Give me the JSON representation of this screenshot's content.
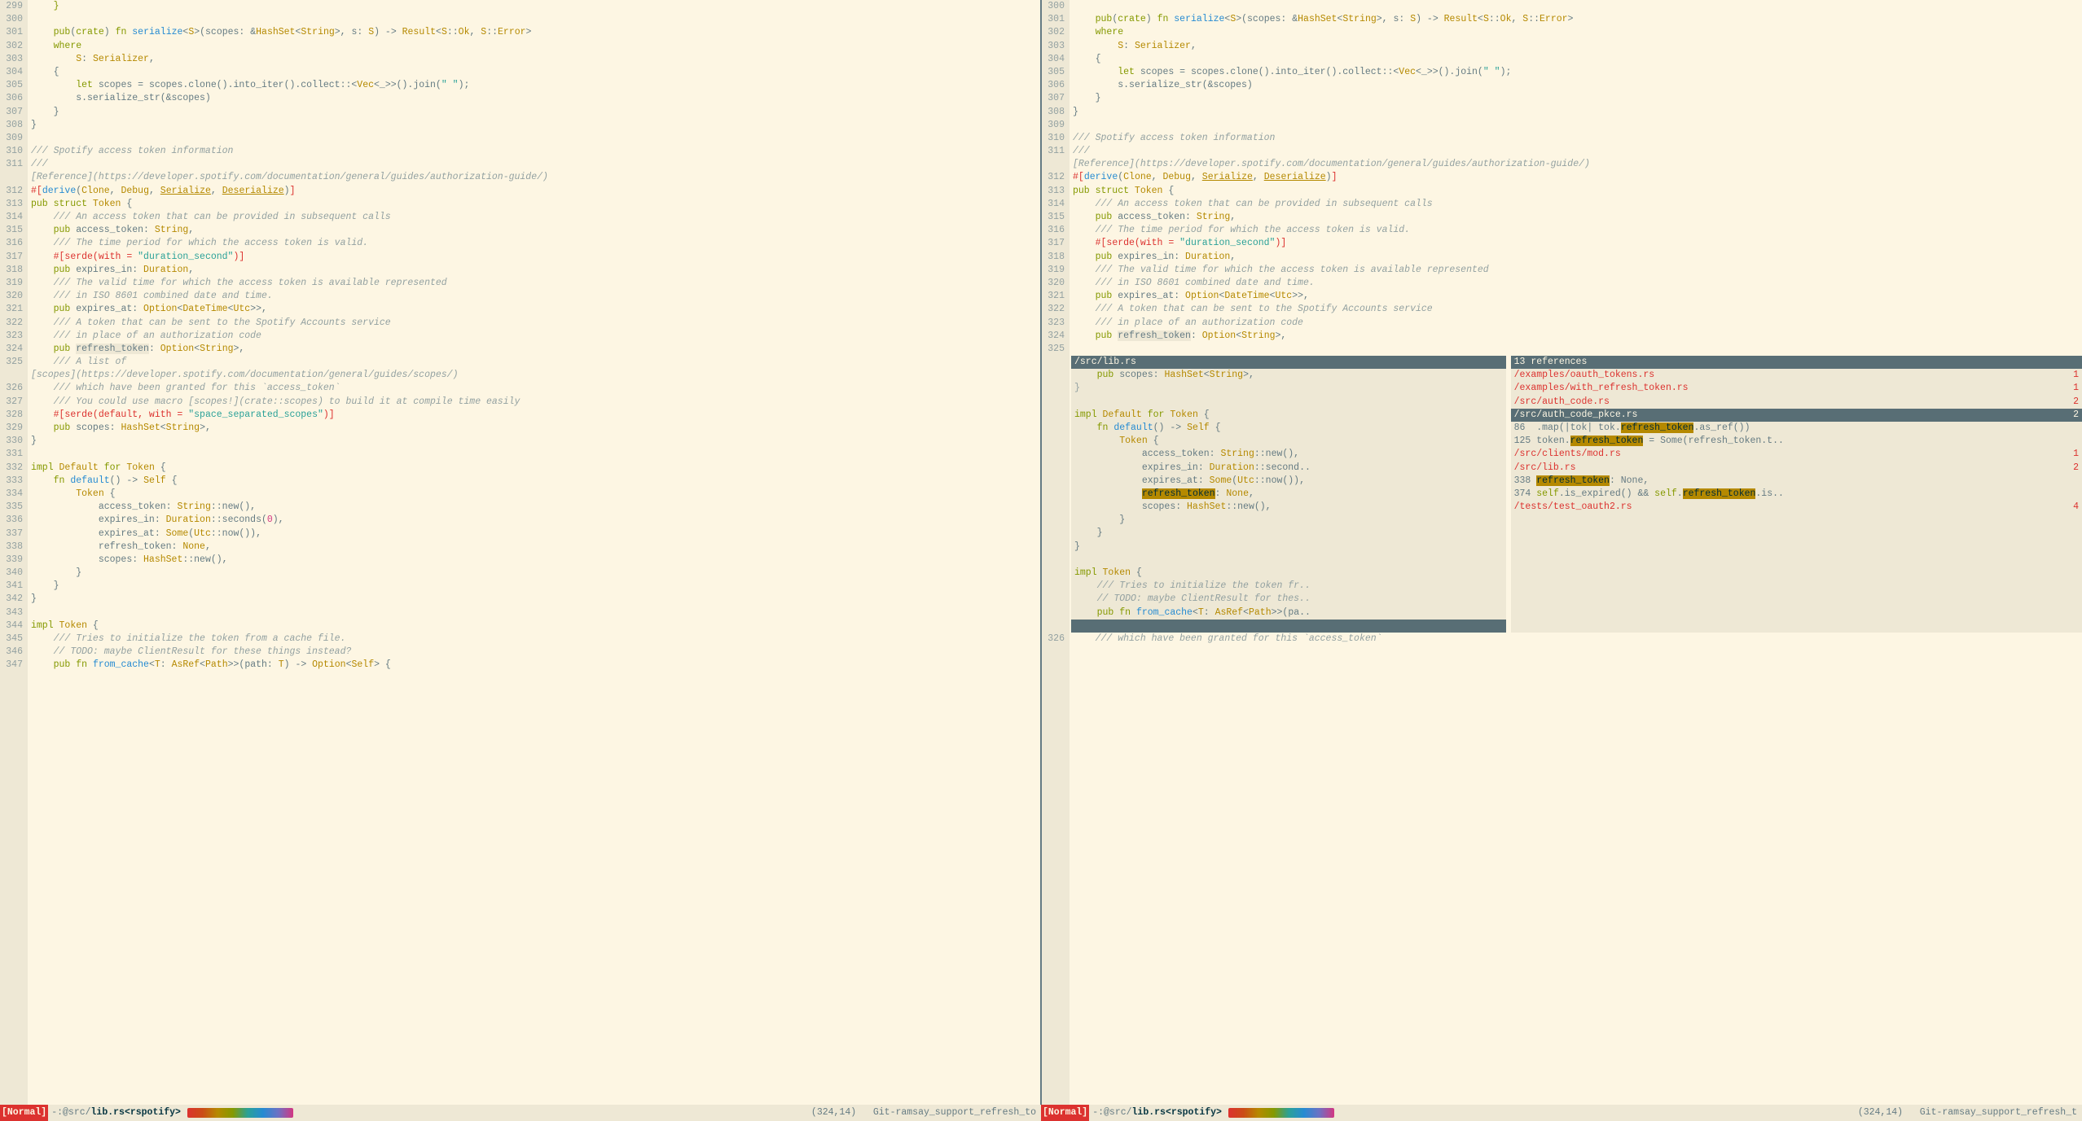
{
  "left": {
    "lines": [
      {
        "n": 299,
        "html": "    <span class='k-keyword'>}</span>"
      },
      {
        "n": 300,
        "html": ""
      },
      {
        "n": 301,
        "html": "    <span class='k-keyword'>pub</span>(<span class='k-keyword'>crate</span>) <span class='k-keyword'>fn</span> <span class='k-fn'>serialize</span>&lt;<span class='k-type'>S</span>&gt;(scopes: &amp;<span class='k-type'>HashSet</span>&lt;<span class='k-type'>String</span>&gt;, s: <span class='k-type'>S</span>) -&gt; <span class='k-type'>Result</span>&lt;<span class='k-type'>S</span>::<span class='k-type'>Ok</span>, <span class='k-type'>S</span>::<span class='k-type'>Error</span>&gt;"
      },
      {
        "n": 302,
        "html": "    <span class='k-keyword'>where</span>"
      },
      {
        "n": 303,
        "html": "        <span class='k-type'>S</span>: <span class='k-type'>Serializer</span>,"
      },
      {
        "n": 304,
        "html": "    {"
      },
      {
        "n": 305,
        "html": "        <span class='k-keyword'>let</span> scopes = scopes.clone().into_iter().collect::&lt;<span class='k-type'>Vec</span>&lt;_&gt;&gt;().join(<span class='k-string'>\" \"</span>);"
      },
      {
        "n": 306,
        "html": "        s.serialize_str(&amp;scopes)"
      },
      {
        "n": 307,
        "html": "    }"
      },
      {
        "n": 308,
        "html": "}"
      },
      {
        "n": 309,
        "html": ""
      },
      {
        "n": 310,
        "html": "<span class='k-comment'>/// Spotify access token information</span>"
      },
      {
        "n": 311,
        "html": "<span class='k-comment'>///</span>"
      },
      {
        "n": "",
        "html": "<span class='k-comment'>[Reference](https://developer.spotify.com/documentation/general/guides/authorization-guide/)</span>"
      },
      {
        "n": 312,
        "html": "<span class='k-attr'>#[</span><span class='k-fn'>derive</span>(<span class='k-type'>Clone</span>, <span class='k-type'>Debug</span>, <span class='k-underline k-type'>Serialize</span>, <span class='k-underline k-type'>Deserialize</span>)<span class='k-attr'>]</span>"
      },
      {
        "n": 313,
        "html": "<span class='k-keyword'>pub struct</span> <span class='k-type'>Token</span> {"
      },
      {
        "n": 314,
        "html": "    <span class='k-comment'>/// An access token that can be provided in subsequent calls</span>"
      },
      {
        "n": 315,
        "html": "    <span class='k-keyword'>pub</span> access_token: <span class='k-type'>String</span>,"
      },
      {
        "n": 316,
        "html": "    <span class='k-comment'>/// The time period for which the access token is valid.</span>"
      },
      {
        "n": 317,
        "html": "    <span class='k-attr'>#[serde(with = <span class='k-string'>\"duration_second\"</span>)]</span>"
      },
      {
        "n": 318,
        "html": "    <span class='k-keyword'>pub</span> expires_in: <span class='k-type'>Duration</span>,"
      },
      {
        "n": 319,
        "html": "    <span class='k-comment'>/// The valid time for which the access token is available represented</span>"
      },
      {
        "n": 320,
        "html": "    <span class='k-comment'>/// in ISO 8601 combined date and time.</span>"
      },
      {
        "n": 321,
        "html": "    <span class='k-keyword'>pub</span> expires_at: <span class='k-type'>Option</span>&lt;<span class='k-type'>DateTime</span>&lt;<span class='k-type'>Utc</span>&gt;&gt;,"
      },
      {
        "n": 322,
        "html": "    <span class='k-comment'>/// A token that can be sent to the Spotify Accounts service</span>"
      },
      {
        "n": 323,
        "html": "    <span class='k-comment'>/// in place of an authorization code</span>"
      },
      {
        "n": 324,
        "html": "    <span class='k-keyword'>pub</span> <span class='cursor-highlight'>refresh_token</span>: <span class='k-type'>Option</span>&lt;<span class='k-type'>String</span>&gt;,"
      },
      {
        "n": 325,
        "html": "    <span class='k-comment'>/// A list of</span>"
      },
      {
        "n": "",
        "html": "<span class='k-comment'>[scopes](https://developer.spotify.com/documentation/general/guides/scopes/)</span>"
      },
      {
        "n": 326,
        "html": "    <span class='k-comment'>/// which have been granted for this `access_token`</span>"
      },
      {
        "n": 327,
        "html": "    <span class='k-comment'>/// You could use macro [scopes!](crate::scopes) to build it at compile time easily</span>"
      },
      {
        "n": 328,
        "html": "    <span class='k-attr'>#[serde(default, with = <span class='k-string'>\"space_separated_scopes\"</span>)]</span>"
      },
      {
        "n": 329,
        "html": "    <span class='k-keyword'>pub</span> scopes: <span class='k-type'>HashSet</span>&lt;<span class='k-type'>String</span>&gt;,"
      },
      {
        "n": 330,
        "html": "}"
      },
      {
        "n": 331,
        "html": ""
      },
      {
        "n": 332,
        "html": "<span class='k-keyword'>impl</span> <span class='k-type'>Default</span> <span class='k-keyword'>for</span> <span class='k-type'>Token</span> {"
      },
      {
        "n": 333,
        "html": "    <span class='k-keyword'>fn</span> <span class='k-fn'>default</span>() -&gt; <span class='k-type'>Self</span> {"
      },
      {
        "n": 334,
        "html": "        <span class='k-type'>Token</span> {"
      },
      {
        "n": 335,
        "html": "            access_token: <span class='k-type'>String</span>::new(),"
      },
      {
        "n": 336,
        "html": "            expires_in: <span class='k-type'>Duration</span>::seconds(<span class='k-magenta'>0</span>),"
      },
      {
        "n": 337,
        "html": "            expires_at: <span class='k-type'>Some</span>(<span class='k-type'>Utc</span>::now()),"
      },
      {
        "n": 338,
        "html": "            refresh_token: <span class='k-type'>None</span>,"
      },
      {
        "n": 339,
        "html": "            scopes: <span class='k-type'>HashSet</span>::new(),"
      },
      {
        "n": 340,
        "html": "        }"
      },
      {
        "n": 341,
        "html": "    }"
      },
      {
        "n": 342,
        "html": "}"
      },
      {
        "n": 343,
        "html": ""
      },
      {
        "n": 344,
        "html": "<span class='k-keyword'>impl</span> <span class='k-type'>Token</span> {"
      },
      {
        "n": 345,
        "html": "    <span class='k-comment'>/// Tries to initialize the token from a cache file.</span>"
      },
      {
        "n": 346,
        "html": "    <span class='k-comment'>// TODO: maybe ClientResult for these things instead?</span>"
      },
      {
        "n": 347,
        "html": "    <span class='k-keyword'>pub fn</span> <span class='k-fn'>from_cache</span>&lt;<span class='k-type'>T</span>: <span class='k-type'>AsRef</span>&lt;<span class='k-type'>Path</span>&gt;&gt;(path: <span class='k-type'>T</span>) -&gt; <span class='k-type'>Option</span>&lt;<span class='k-type'>Self</span>&gt; {"
      }
    ]
  },
  "right": {
    "lines": [
      {
        "n": 300,
        "html": ""
      },
      {
        "n": 301,
        "html": "    <span class='k-keyword'>pub</span>(<span class='k-keyword'>crate</span>) <span class='k-keyword'>fn</span> <span class='k-fn'>serialize</span>&lt;<span class='k-type'>S</span>&gt;(scopes: &amp;<span class='k-type'>HashSet</span>&lt;<span class='k-type'>String</span>&gt;, s: <span class='k-type'>S</span>) -&gt; <span class='k-type'>Result</span>&lt;<span class='k-type'>S</span>::<span class='k-type'>Ok</span>, <span class='k-type'>S</span>::<span class='k-type'>Error</span>&gt;"
      },
      {
        "n": 302,
        "html": "    <span class='k-keyword'>where</span>"
      },
      {
        "n": 303,
        "html": "        <span class='k-type'>S</span>: <span class='k-type'>Serializer</span>,"
      },
      {
        "n": 304,
        "html": "    {"
      },
      {
        "n": 305,
        "html": "        <span class='k-keyword'>let</span> scopes = scopes.clone().into_iter().collect::&lt;<span class='k-type'>Vec</span>&lt;_&gt;&gt;().join(<span class='k-string'>\" \"</span>);"
      },
      {
        "n": 306,
        "html": "        s.serialize_str(&amp;scopes)"
      },
      {
        "n": 307,
        "html": "    }"
      },
      {
        "n": 308,
        "html": "}"
      },
      {
        "n": 309,
        "html": ""
      },
      {
        "n": 310,
        "html": "<span class='k-comment'>/// Spotify access token information</span>"
      },
      {
        "n": 311,
        "html": "<span class='k-comment'>///</span>"
      },
      {
        "n": "",
        "html": "<span class='k-comment'>[Reference](https://developer.spotify.com/documentation/general/guides/authorization-guide/)</span>"
      },
      {
        "n": 312,
        "html": "<span class='k-attr'>#[</span><span class='k-fn'>derive</span>(<span class='k-type'>Clone</span>, <span class='k-type'>Debug</span>, <span class='k-underline k-type'>Serialize</span>, <span class='k-underline k-type'>Deserialize</span>)<span class='k-attr'>]</span>"
      },
      {
        "n": 313,
        "html": "<span class='k-keyword'>pub struct</span> <span class='k-type'>Token</span> {"
      },
      {
        "n": 314,
        "html": "    <span class='k-comment'>/// An access token that can be provided in subsequent calls</span>"
      },
      {
        "n": 315,
        "html": "    <span class='k-keyword'>pub</span> access_token: <span class='k-type'>String</span>,"
      },
      {
        "n": 316,
        "html": "    <span class='k-comment'>/// The time period for which the access token is valid.</span>"
      },
      {
        "n": 317,
        "html": "    <span class='k-attr'>#[serde(with = <span class='k-string'>\"duration_second\"</span>)]</span>"
      },
      {
        "n": 318,
        "html": "    <span class='k-keyword'>pub</span> expires_in: <span class='k-type'>Duration</span>,"
      },
      {
        "n": 319,
        "html": "    <span class='k-comment'>/// The valid time for which the access token is available represented</span>"
      },
      {
        "n": 320,
        "html": "    <span class='k-comment'>/// in ISO 8601 combined date and time.</span>"
      },
      {
        "n": 321,
        "html": "    <span class='k-keyword'>pub</span> expires_at: <span class='k-type'>Option</span>&lt;<span class='k-type'>DateTime</span>&lt;<span class='k-type'>Utc</span>&gt;&gt;,"
      },
      {
        "n": 322,
        "html": "    <span class='k-comment'>/// A token that can be sent to the Spotify Accounts service</span>"
      },
      {
        "n": 323,
        "html": "    <span class='k-comment'>/// in place of an authorization code</span>"
      },
      {
        "n": 324,
        "html": "    <span class='k-keyword'>pub</span> <span class='cursor-highlight'>refresh_token</span>: <span class='k-type'>Option</span>&lt;<span class='k-type'>String</span>&gt;,"
      },
      {
        "n": 325,
        "html": ""
      },
      {
        "n": "",
        "html": ""
      },
      {
        "n": "",
        "html": ""
      },
      {
        "n": "",
        "html": ""
      },
      {
        "n": "",
        "html": ""
      },
      {
        "n": "",
        "html": ""
      },
      {
        "n": "",
        "html": ""
      },
      {
        "n": "",
        "html": ""
      },
      {
        "n": "",
        "html": ""
      },
      {
        "n": "",
        "html": ""
      },
      {
        "n": "",
        "html": ""
      },
      {
        "n": "",
        "html": ""
      },
      {
        "n": "",
        "html": ""
      },
      {
        "n": "",
        "html": ""
      },
      {
        "n": "",
        "html": ""
      },
      {
        "n": "",
        "html": ""
      },
      {
        "n": "",
        "html": ""
      },
      {
        "n": "",
        "html": ""
      },
      {
        "n": "",
        "html": ""
      },
      {
        "n": "",
        "html": ""
      },
      {
        "n": "",
        "html": "    <span class='k-comment'>/// A list of</span>"
      },
      {
        "n": "",
        "html": "<span class='k-comment'>[scopes](https://developer.spotify.com/documentation/general/guides/scopes/)</span>"
      },
      {
        "n": 326,
        "html": "    <span class='k-comment'>/// which have been granted for this `access_token`</span>"
      }
    ]
  },
  "overlay": {
    "preview_title": "/src/lib.rs",
    "preview_lines": [
      "    <span class='k-keyword'>pub</span> scopes: <span class='k-type'>HashSet</span>&lt;<span class='k-type'>String</span>&gt;,",
      "<span style='color:#93a1a1'>}</span>",
      "",
      "<span class='k-keyword'>impl</span> <span class='k-type'>Default</span> <span class='k-keyword'>for</span> <span class='k-type'>Token</span> {",
      "    <span class='k-keyword'>fn</span> <span class='k-fn'>default</span>() -&gt; <span class='k-type'>Self</span> {",
      "        <span class='k-type'>Token</span> {",
      "            access_token: <span class='k-type'>String</span>::new(),",
      "            expires_in: <span class='k-type'>Duration</span>::second..",
      "            expires_at: <span class='k-type'>Some</span>(<span class='k-type'>Utc</span>::now()),",
      "            <span class='hl-token'>refresh_token</span>: <span class='k-type'>None</span>,",
      "            scopes: <span class='k-type'>HashSet</span>::new(),",
      "        }",
      "    }",
      "}",
      "",
      "<span class='k-keyword'>impl</span> <span class='k-type'>Token</span> {",
      "    <span class='k-comment'>/// Tries to initialize the token fr..</span>",
      "    <span class='k-comment'>// TODO: maybe ClientResult for thes..</span>",
      "    <span class='k-keyword'>pub fn</span> <span class='k-fn'>from_cache</span>&lt;<span class='k-type'>T</span>: <span class='k-type'>AsRef</span>&lt;<span class='k-type'>Path</span>&gt;&gt;(pa.."
    ],
    "refs_title": "13 references",
    "refs": [
      {
        "path": "/examples/oauth_tokens.rs",
        "count": "1",
        "selected": false
      },
      {
        "path": "/examples/with_refresh_token.rs",
        "count": "1",
        "selected": false
      },
      {
        "path": "/src/auth_code.rs",
        "count": "2",
        "selected": false
      },
      {
        "path": "/src/auth_code_pkce.rs",
        "count": "2",
        "selected": true
      },
      {
        "html": "86  .map(|tok| tok.<span class='hl-token'>refresh_token</span>.as_ref())"
      },
      {
        "html": "125 token.<span class='hl-token'>refresh_token</span> = Some(refresh_token.t.."
      },
      {
        "path": "/src/clients/mod.rs",
        "count": "1",
        "selected": false
      },
      {
        "path": "/src/lib.rs",
        "count": "2",
        "selected": false
      },
      {
        "html": "338 <span class='hl-token'>refresh_token</span>: None,"
      },
      {
        "html": "374 <span class='k-keyword'>self</span>.is_expired() &amp;&amp; <span class='k-keyword'>self</span>.<span class='hl-token'>refresh_token</span>.is.."
      },
      {
        "path": "/tests/test_oauth2.rs",
        "count": "4",
        "selected": false
      }
    ]
  },
  "status": {
    "left": {
      "mode": "[Normal]",
      "path_prefix": "-:@src/",
      "path_bold": "lib.rs<rspotify>",
      "pos": "(324,14)",
      "branch": "Git-ramsay_support_refresh_to"
    },
    "right": {
      "mode": "[Normal]",
      "path_prefix": "-:@src/",
      "path_bold": "lib.rs<rspotify>",
      "pos": "(324,14)",
      "branch": "Git-ramsay_support_refresh_t"
    }
  }
}
